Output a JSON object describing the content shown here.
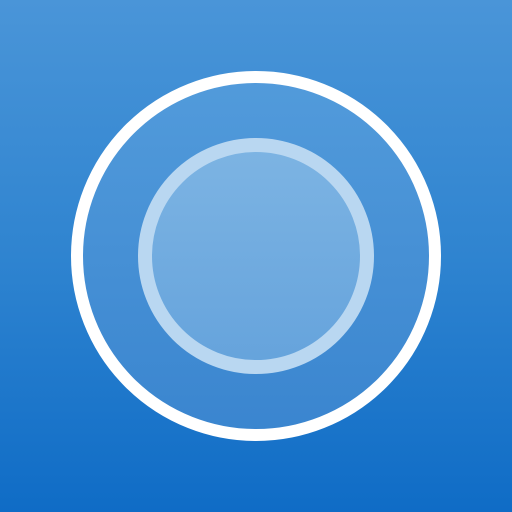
{
  "icon": {
    "name": "Cortana",
    "colors": {
      "background_top": "#4a95d8",
      "background_mid": "#2f84d0",
      "background_bottom": "#0f6cc6",
      "outer_ring": "#ffffff",
      "outer_disc": "#4790d4",
      "inner_ring": "#b8d6f0",
      "inner_disc": "#72acdf"
    }
  }
}
